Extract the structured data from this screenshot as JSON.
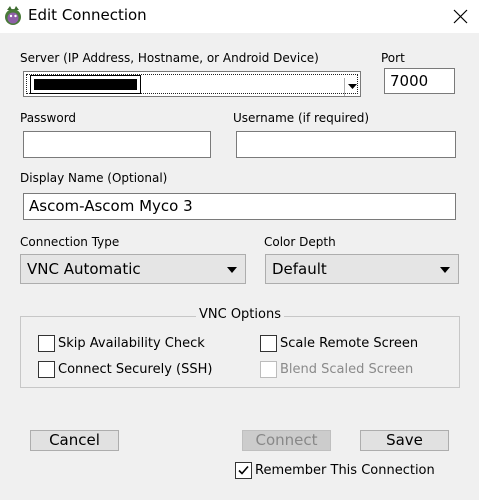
{
  "window": {
    "title": "Edit Connection",
    "app_icon": "app-icon",
    "close_icon": "close-icon"
  },
  "server": {
    "label": "Server (IP Address, Hostname, or Android Device)",
    "value_redacted": true,
    "dropdown_icon": "chevron-down-icon"
  },
  "port": {
    "label": "Port",
    "value": "7000"
  },
  "password": {
    "label": "Password",
    "value": ""
  },
  "username": {
    "label": "Username (if required)",
    "value": ""
  },
  "display_name": {
    "label": "Display Name (Optional)",
    "value": "Ascom-Ascom Myco 3"
  },
  "connection_type": {
    "label": "Connection Type",
    "value": "VNC Automatic"
  },
  "color_depth": {
    "label": "Color Depth",
    "value": "Default"
  },
  "vnc_options": {
    "title": "VNC Options",
    "skip_availability": {
      "label": "Skip Availability Check",
      "checked": false,
      "enabled": true
    },
    "scale_remote": {
      "label": "Scale Remote Screen",
      "checked": false,
      "enabled": true
    },
    "connect_securely": {
      "label": "Connect Securely (SSH)",
      "checked": false,
      "enabled": true
    },
    "blend_scaled": {
      "label": "Blend Scaled Screen",
      "checked": false,
      "enabled": false
    }
  },
  "buttons": {
    "cancel": "Cancel",
    "connect": "Connect",
    "save": "Save"
  },
  "remember": {
    "label": "Remember This Connection",
    "checked": true
  }
}
